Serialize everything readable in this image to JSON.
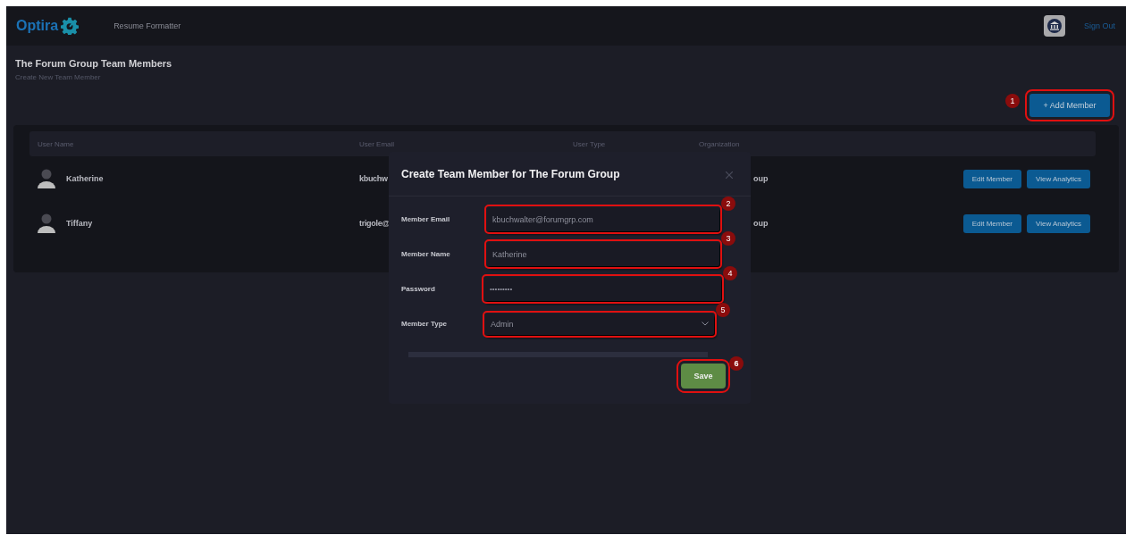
{
  "nav": {
    "brand": "Optira",
    "links": [
      {
        "label": "Resume Formatter"
      }
    ],
    "sign_out": "Sign Out"
  },
  "page": {
    "title": "The Forum Group Team Members",
    "subtitle": "Create New Team Member",
    "add_button": {
      "label": "+ Add Member",
      "callout": "1"
    }
  },
  "table": {
    "columns": [
      "User Name",
      "User Email",
      "User Type",
      "Organization"
    ],
    "rows": [
      {
        "name": "Katherine",
        "email": "kbuchw",
        "organization": "oup",
        "actions": [
          "Edit Member",
          "View Analytics"
        ]
      },
      {
        "name": "Tiffany",
        "email": "trigole@",
        "organization": "oup",
        "actions": [
          "Edit Member",
          "View Analytics"
        ]
      }
    ]
  },
  "modal": {
    "title": "Create Team Member for The Forum Group",
    "fields": [
      {
        "kind": "text",
        "label": "Member Email",
        "value": "kbuchwalter@forumgrp.com",
        "callout": "2"
      },
      {
        "kind": "text",
        "label": "Member Name",
        "value": "Katherine",
        "callout": "3"
      },
      {
        "kind": "password",
        "label": "Password",
        "value": "•••••••••",
        "callout": "4"
      },
      {
        "kind": "select",
        "label": "Member Type",
        "value": "Admin",
        "callout": "5"
      }
    ],
    "save": {
      "label": "Save",
      "callout": "6"
    }
  }
}
